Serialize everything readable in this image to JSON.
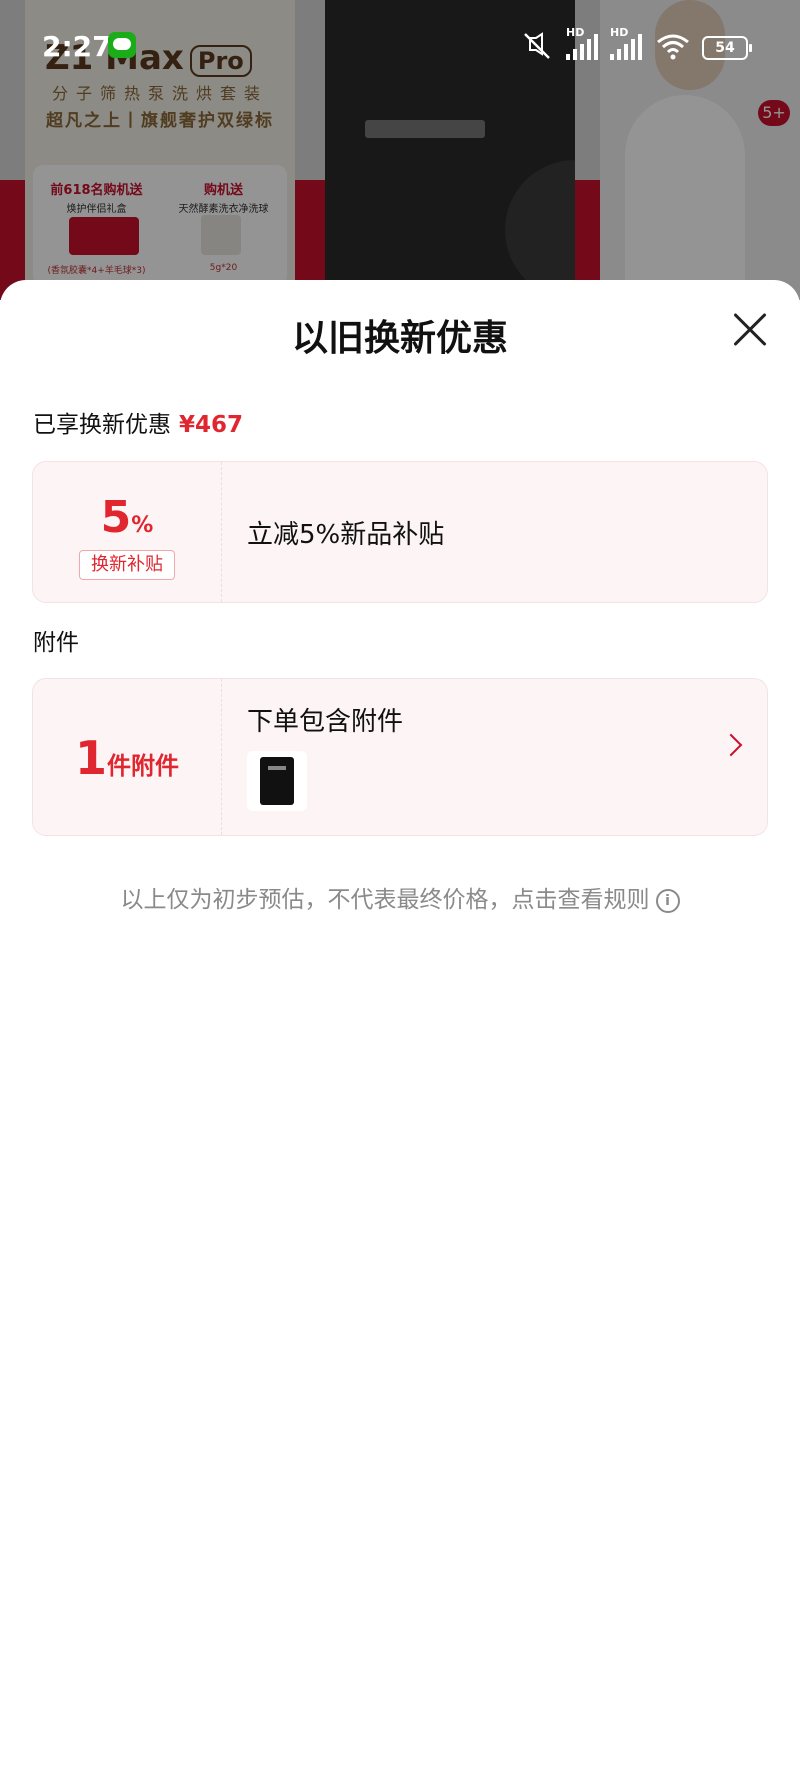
{
  "background": {
    "brand_text": "Z1 Max",
    "brand_badge": "Pro",
    "tagline1": "分子筛热泵洗烘套装",
    "tagline2": "超凡之上丨旗舰奢护双绿标",
    "promo_left_title": "前618名购机送",
    "promo_left_sub": "焕护伴侣礼盒",
    "promo_left_foot": "(香氛胶囊*4+羊毛球*3)",
    "promo_right_title": "购机送",
    "promo_right_sub": "天然酵素洗衣净洗球",
    "promo_right_foot": "5g*20",
    "badge": "5+"
  },
  "status_bar": {
    "time": "2:27",
    "battery": "54",
    "icons": [
      "wechat-icon",
      "mute-icon",
      "signal-icon",
      "signal-icon",
      "wifi-icon",
      "battery-icon"
    ]
  },
  "sheet": {
    "title": "以旧换新优惠",
    "enjoyed_label": "已享换新优惠",
    "enjoyed_amount": "¥467",
    "subsidy": {
      "percent": "5",
      "percent_sign": "%",
      "tag": "换新补贴",
      "description": "立减5%新品补贴"
    },
    "accessories_section": "附件",
    "accessory": {
      "count": "1",
      "unit": "件附件",
      "description": "下单包含附件"
    },
    "note": "以上仅为初步预估，不代表最终价格，点击查看规则",
    "info_glyph": "i"
  },
  "colors": {
    "accent": "#e0262f",
    "card_bg": "#fdf5f5",
    "muted_text": "#8a8a8a"
  }
}
